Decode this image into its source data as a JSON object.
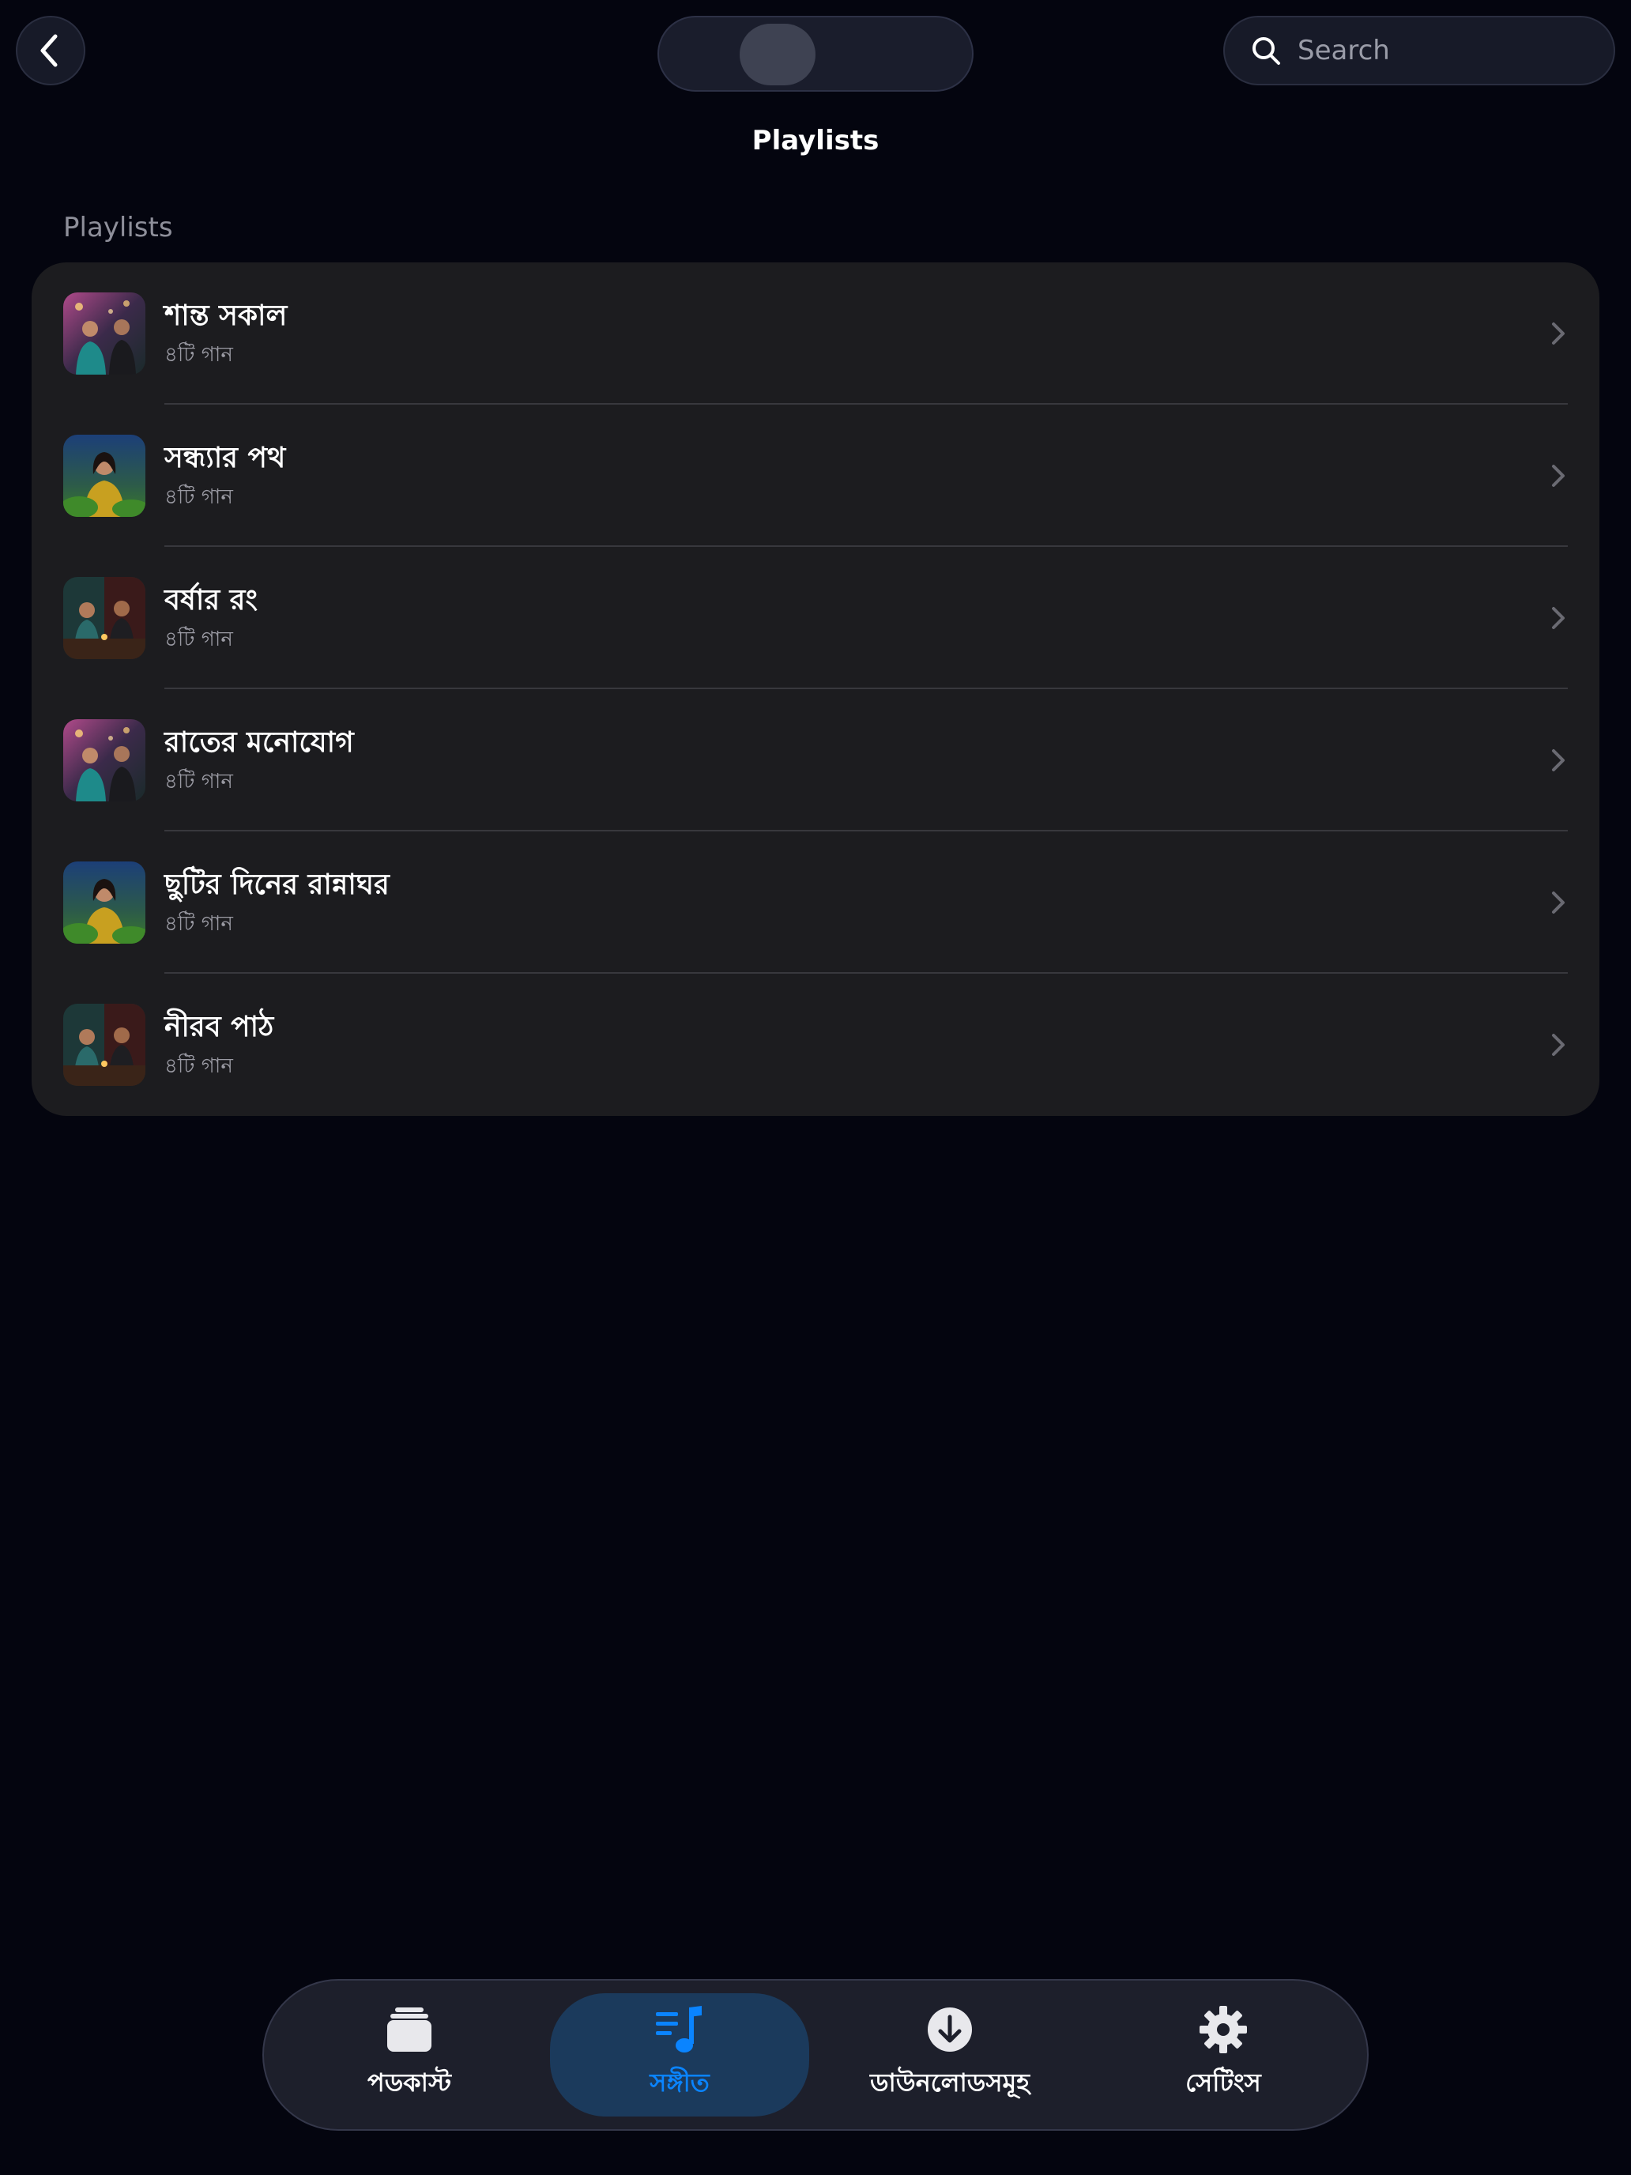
{
  "header": {
    "title": "Playlists",
    "search_placeholder": "Search"
  },
  "section": {
    "header": "Playlists"
  },
  "playlists": [
    {
      "title": "শান্ত সকাল",
      "subtitle": "৪টি গান",
      "artwork": "couple-city-lights-art"
    },
    {
      "title": "সন্ধ্যার পথ",
      "subtitle": "৪টি গান",
      "artwork": "woman-garden-art"
    },
    {
      "title": "বর্ষার রং",
      "subtitle": "৪টি গান",
      "artwork": "couple-cafe-table-art"
    },
    {
      "title": "রাতের মনোযোগ",
      "subtitle": "৪টি গান",
      "artwork": "couple-city-lights-art"
    },
    {
      "title": "ছুটির দিনের রান্নাঘর",
      "subtitle": "৪টি গান",
      "artwork": "woman-garden-art"
    },
    {
      "title": "নীরব পাঠ",
      "subtitle": "৪টি গান",
      "artwork": "couple-cafe-table-art"
    }
  ],
  "tabs": [
    {
      "label": "পডকাস্ট",
      "icon": "podcast-stack-icon",
      "active": false
    },
    {
      "label": "সঙ্গীত",
      "icon": "music-note-list-icon",
      "active": true
    },
    {
      "label": "ডাউনলোডসমূহ",
      "icon": "download-circle-icon",
      "active": false
    },
    {
      "label": "সেটিংস",
      "icon": "gear-icon",
      "active": false
    }
  ],
  "colors": {
    "background": "#04050f",
    "card": "#1c1c1f",
    "accent": "#0a84ff",
    "active_tab_bg": "#1b3a5c"
  }
}
